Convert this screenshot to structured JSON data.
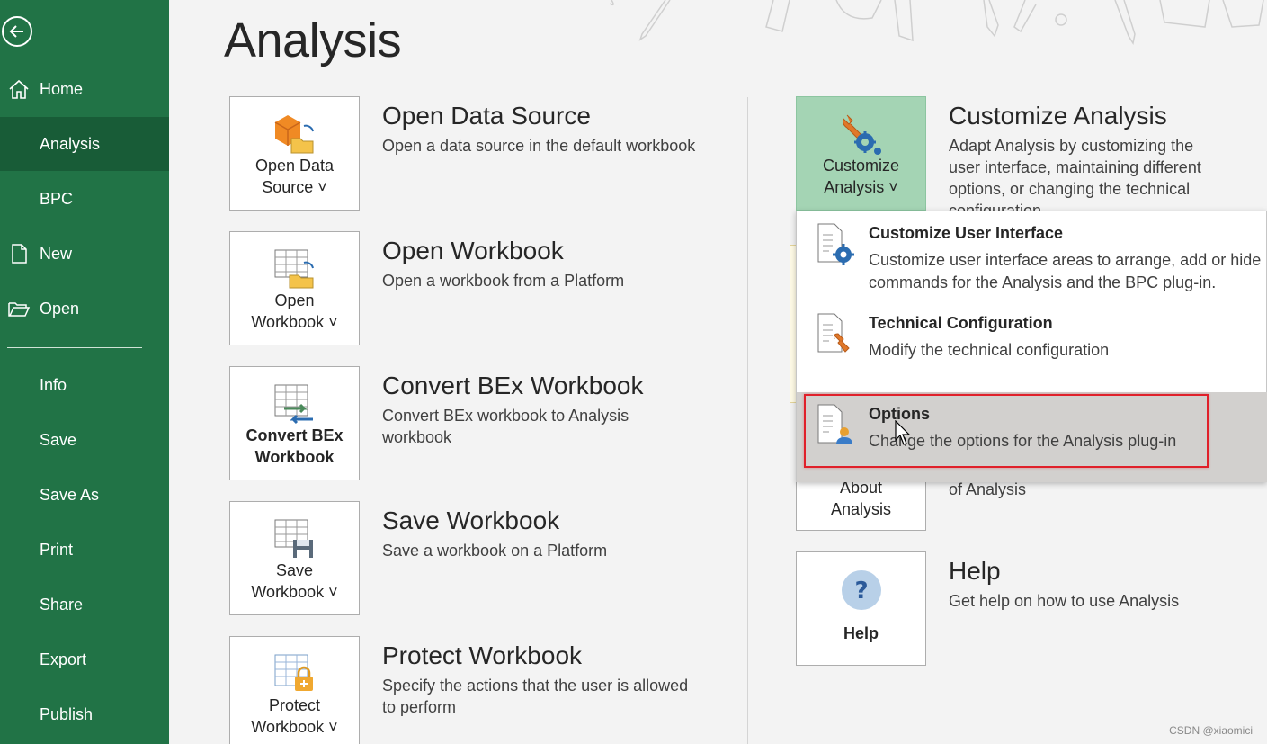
{
  "sidebar": {
    "items": [
      {
        "label": "Home",
        "icon": "home-icon"
      },
      {
        "label": "Analysis",
        "active": true
      },
      {
        "label": "BPC"
      },
      {
        "label": "New",
        "icon": "new-doc-icon"
      },
      {
        "label": "Open",
        "icon": "folder-open-icon"
      },
      {
        "label": "Info"
      },
      {
        "label": "Save"
      },
      {
        "label": "Save As"
      },
      {
        "label": "Print"
      },
      {
        "label": "Share"
      },
      {
        "label": "Export"
      },
      {
        "label": "Publish"
      }
    ]
  },
  "page": {
    "title": "Analysis"
  },
  "left_tiles": [
    {
      "label_line1": "Open Data",
      "label_line2": "Source ˅",
      "title": "Open Data Source",
      "text": "Open a data source in the default workbook",
      "icon": "open-data-source-icon"
    },
    {
      "label_line1": "Open",
      "label_line2": "Workbook ˅",
      "title": "Open Workbook",
      "text": "Open a workbook from a Platform",
      "icon": "open-workbook-icon"
    },
    {
      "label_line1": "Convert BEx",
      "label_line2": "Workbook",
      "title": "Convert BEx Workbook",
      "text": "Convert BEx workbook to Analysis workbook",
      "icon": "convert-workbook-icon"
    },
    {
      "label_line1": "Save",
      "label_line2": "Workbook ˅",
      "title": "Save Workbook",
      "text": "Save a workbook on a Platform",
      "icon": "save-workbook-icon"
    },
    {
      "label_line1": "Protect",
      "label_line2": "Workbook ˅",
      "title": "Protect Workbook",
      "text": "Specify the actions that the user is allowed to perform",
      "icon": "protect-workbook-icon"
    }
  ],
  "right_tiles": [
    {
      "label_line1": "Customize",
      "label_line2": "Analysis ˅",
      "title": "Customize Analysis",
      "text": "Adapt Analysis by customizing the user interface, maintaining different options, or changing the technical configuration",
      "icon": "customize-analysis-icon"
    },
    {
      "label_line1": "About",
      "label_line2": "Analysis",
      "title": "",
      "text": "of Analysis",
      "icon": ""
    },
    {
      "label_line1": "",
      "label_line2": "Help",
      "title": "Help",
      "text": "Get help on how to use Analysis",
      "icon": "help-icon"
    }
  ],
  "menu": {
    "items": [
      {
        "title": "Customize User Interface",
        "text": "Customize user interface areas to arrange, add or hide commands for the Analysis and the BPC plug-in.",
        "icon": "customize-ui-icon"
      },
      {
        "title": "Technical Configuration",
        "text": "Modify the technical configuration",
        "icon": "technical-config-icon"
      },
      {
        "title": "Options",
        "text": "Change the options for the Analysis plug-in",
        "icon": "options-icon",
        "hovered": true
      }
    ]
  },
  "watermark": "CSDN @xiaomici",
  "colors": {
    "sidebar": "#217346",
    "sidebar_active": "#185c37",
    "tile_active": "#a4d4b4",
    "highlight": "#e0202a"
  }
}
